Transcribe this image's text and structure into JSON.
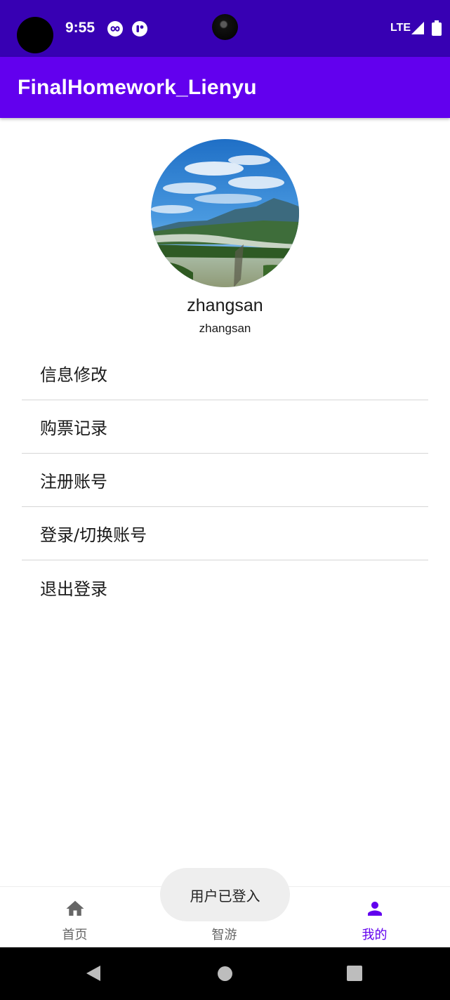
{
  "status_bar": {
    "time": "9:55",
    "network": "LTE",
    "icons": [
      "infinity-notification-icon",
      "app-notification-icon",
      "signal-icon",
      "battery-icon"
    ]
  },
  "app_bar": {
    "title": "FinalHomework_Lienyu"
  },
  "profile": {
    "avatar": "landscape-avatar",
    "display_name": "zhangsan",
    "username": "zhangsan"
  },
  "menu": {
    "items": [
      {
        "label": "信息修改"
      },
      {
        "label": "购票记录"
      },
      {
        "label": "注册账号"
      },
      {
        "label": "登录/切换账号"
      },
      {
        "label": "退出登录"
      }
    ]
  },
  "bottom_nav": {
    "items": [
      {
        "label": "首页",
        "icon": "home-icon",
        "active": false
      },
      {
        "label": "智游",
        "icon": "bus-icon",
        "active": false
      },
      {
        "label": "我的",
        "icon": "person-icon",
        "active": true
      }
    ]
  },
  "toast": {
    "message": "用户已登入"
  },
  "colors": {
    "status_bar": "#3700b3",
    "app_bar": "#6200ee",
    "accent": "#6200ee",
    "inactive": "#666666"
  }
}
